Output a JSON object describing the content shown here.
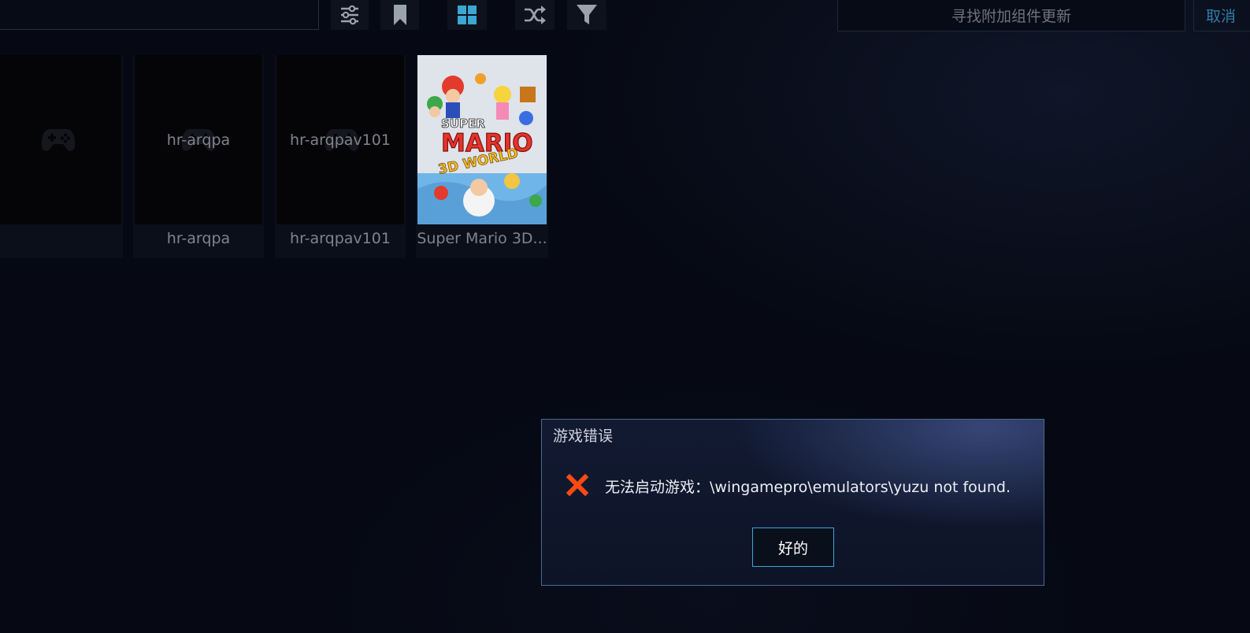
{
  "toolbar": {
    "search_right_placeholder": "寻找附加组件更新",
    "cancel_label": "取消",
    "icons": [
      "sliders-icon",
      "bookmark-icon",
      "grid-icon",
      "shuffle-icon",
      "filter-icon"
    ]
  },
  "games": [
    {
      "cover_text": "",
      "title": "",
      "icon": "gamepad-icon"
    },
    {
      "cover_text": "hr-arqpa",
      "title": "hr-arqpa",
      "icon": "gamepad-icon"
    },
    {
      "cover_text": "hr-arqpav101",
      "title": "hr-arqpav101",
      "icon": "gamepad-icon"
    },
    {
      "cover_text": "",
      "title": "Super Mario 3D..."
    }
  ],
  "mario_cover_logo": [
    "SUPER",
    "MARIO",
    "3D WORLD"
  ],
  "dialog": {
    "title": "游戏错误",
    "message": "无法启动游戏：\\wingamepro\\emulators\\yuzu not found.",
    "ok_label": "好的",
    "icon": "error-x-icon"
  },
  "colors": {
    "accent": "#3ba7d2",
    "error": "#ff4a12",
    "background": "#060913"
  }
}
